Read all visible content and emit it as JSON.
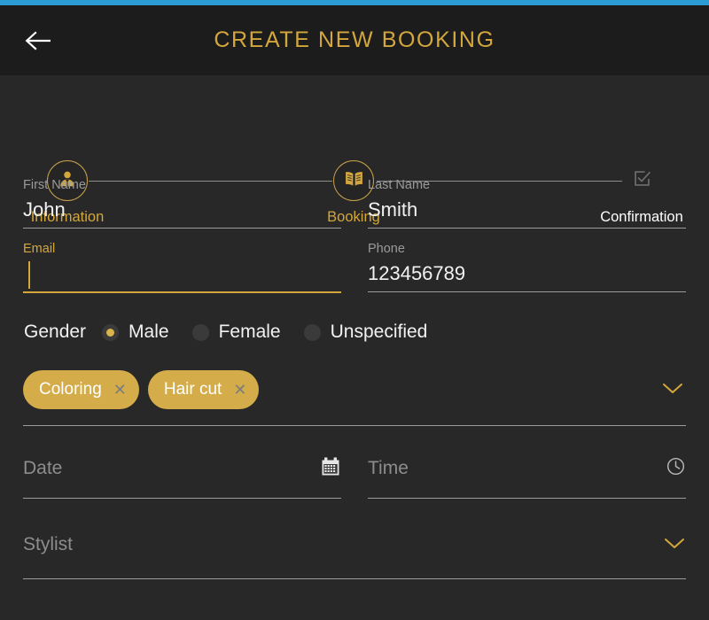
{
  "theme": {
    "accent_gold": "#d4a73c",
    "chip_gold": "#d4ad4a",
    "status_bar_blue": "#2b9dd4",
    "header_bg": "#1c1c1c",
    "body_bg": "#282828",
    "text_white": "#f2f2f2",
    "text_muted": "#8d8d8d"
  },
  "header": {
    "title": "CREATE NEW BOOKING",
    "back_icon": "arrow-left-icon"
  },
  "stepper": {
    "steps": [
      {
        "label": "Information",
        "icon": "user-icon",
        "state": "active"
      },
      {
        "label": "Booking",
        "icon": "book-icon",
        "state": "active"
      },
      {
        "label": "Confirmation",
        "icon": "checkbox-check-icon",
        "state": "inactive"
      }
    ]
  },
  "form": {
    "first_name": {
      "label": "First Name",
      "value": "John"
    },
    "last_name": {
      "label": "Last Name",
      "value": "Smith"
    },
    "email": {
      "label": "Email",
      "value": "",
      "focused": true
    },
    "phone": {
      "label": "Phone",
      "value": "123456789"
    },
    "gender": {
      "label": "Gender",
      "options": [
        {
          "label": "Male",
          "selected": true
        },
        {
          "label": "Female",
          "selected": false
        },
        {
          "label": "Unspecified",
          "selected": false
        }
      ]
    },
    "services": {
      "chips": [
        {
          "label": "Coloring",
          "remove_icon": "close-icon"
        },
        {
          "label": "Hair cut",
          "remove_icon": "close-icon"
        }
      ],
      "chevron_icon": "chevron-down-icon"
    },
    "date": {
      "placeholder": "Date",
      "value": "",
      "icon": "calendar-icon"
    },
    "time": {
      "placeholder": "Time",
      "value": "",
      "icon": "clock-icon"
    },
    "stylist": {
      "placeholder": "Stylist",
      "value": "",
      "icon": "chevron-down-icon"
    }
  }
}
